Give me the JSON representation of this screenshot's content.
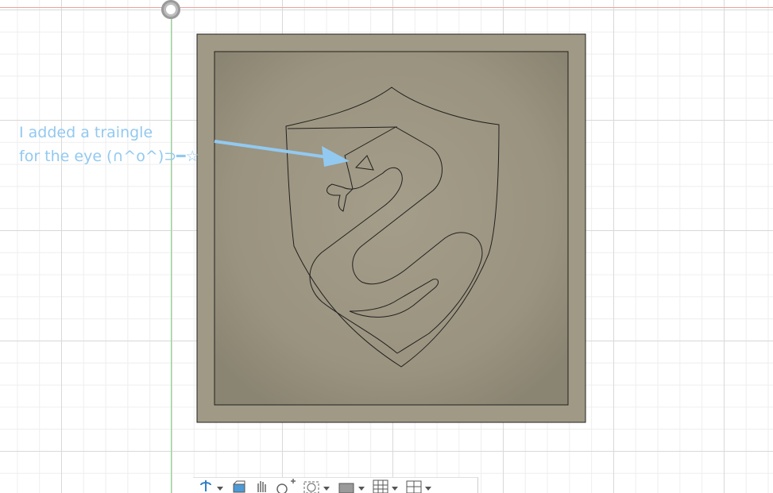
{
  "annotation": {
    "line1": "I added a traingle",
    "line2": "for the eye (∩^o^)⊃━☆"
  },
  "colors": {
    "annotation": "#92c9f0",
    "model_face": "#9e9784",
    "model_edge": "#202020",
    "x_axis": "#f0a0a0",
    "y_axis": "#8fd88f"
  },
  "toolbar": {
    "tools": [
      {
        "icon": "orbit-icon",
        "dropdown": true
      },
      {
        "icon": "look-at-icon",
        "dropdown": false
      },
      {
        "icon": "pan-hand-icon",
        "dropdown": false
      },
      {
        "icon": "zoom-icon",
        "dropdown": false
      },
      {
        "icon": "fit-window-icon",
        "dropdown": true
      },
      {
        "icon": "display-settings-icon",
        "dropdown": true
      },
      {
        "icon": "grid-snaps-icon",
        "dropdown": true
      },
      {
        "icon": "viewports-icon",
        "dropdown": true
      }
    ]
  }
}
